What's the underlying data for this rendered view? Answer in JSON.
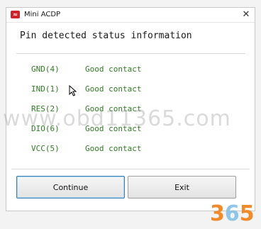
{
  "window": {
    "title": "Mini ACDP",
    "close_glyph": "✕",
    "icon": "acdp-app-icon"
  },
  "dialog": {
    "heading": "Pin detected status information"
  },
  "pins": [
    {
      "name": "GND(4)",
      "status": "Good contact"
    },
    {
      "name": "IND(1)",
      "status": "Good contact"
    },
    {
      "name": "RES(2)",
      "status": "Good contact"
    },
    {
      "name": "DIO(6)",
      "status": "Good contact"
    },
    {
      "name": "VCC(5)",
      "status": "Good contact"
    }
  ],
  "buttons": {
    "continue": "Continue",
    "exit": "Exit"
  },
  "watermark": {
    "site": "www.obd11365.com",
    "logo_a": "3",
    "logo_b": "6",
    "logo_c": "5"
  },
  "colors": {
    "status_text": "#2e7d22",
    "accent": "#3c7fb1"
  }
}
